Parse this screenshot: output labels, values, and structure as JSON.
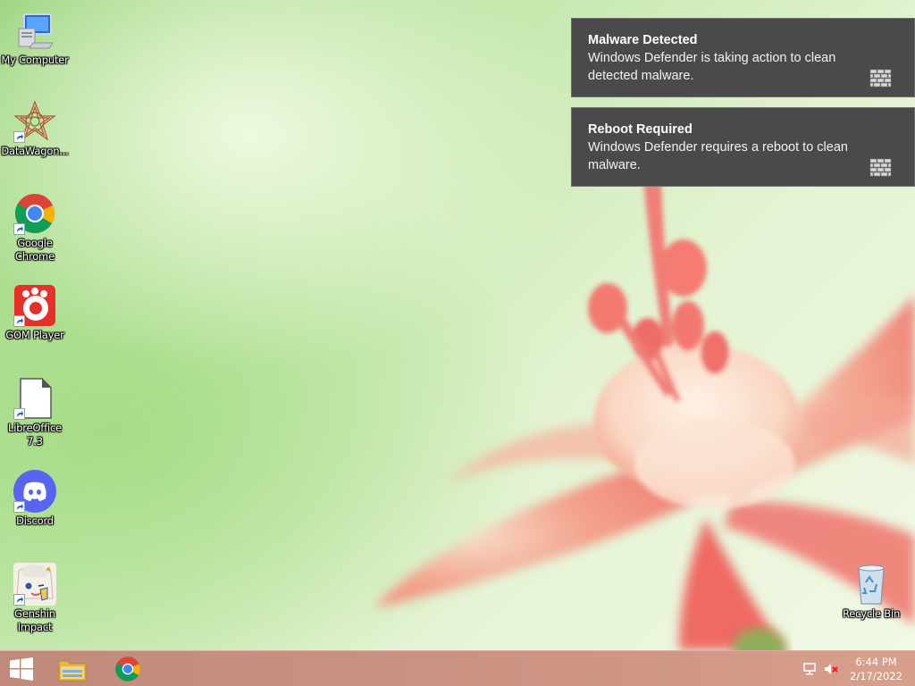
{
  "desktop": {
    "icons": [
      {
        "label": "My Computer",
        "icon": "computer-icon"
      },
      {
        "label": "DataWagon...",
        "icon": "datawagon-icon"
      },
      {
        "label": "Google Chrome",
        "icon": "chrome-icon"
      },
      {
        "label": "GOM Player",
        "icon": "gom-player-icon"
      },
      {
        "label": "LibreOffice 7.3",
        "icon": "libreoffice-icon"
      },
      {
        "label": "Discord",
        "icon": "discord-icon"
      },
      {
        "label": "Genshin Impact",
        "icon": "genshin-icon"
      }
    ],
    "recycle_bin": {
      "label": "Recycle Bin",
      "icon": "recycle-bin-icon"
    }
  },
  "notifications": [
    {
      "title": "Malware Detected",
      "body": "Windows Defender is taking action to clean detected malware.",
      "icon": "defender-wall-icon"
    },
    {
      "title": "Reboot Required",
      "body": "Windows Defender requires a reboot to clean malware.",
      "icon": "defender-wall-icon"
    }
  ],
  "taskbar": {
    "start_icon": "windows-logo-icon",
    "pinned": [
      "file-explorer-icon",
      "chrome-icon"
    ],
    "tray": [
      "network-icon",
      "volume-muted-icon"
    ],
    "time": "6:44 PM",
    "date": "2/17/2022"
  },
  "colors": {
    "toast_bg": "#4a4a4a",
    "taskbar": "#c98f7f",
    "wallpaper_green": "#a6dc86",
    "flower_pink": "#f07a72"
  }
}
